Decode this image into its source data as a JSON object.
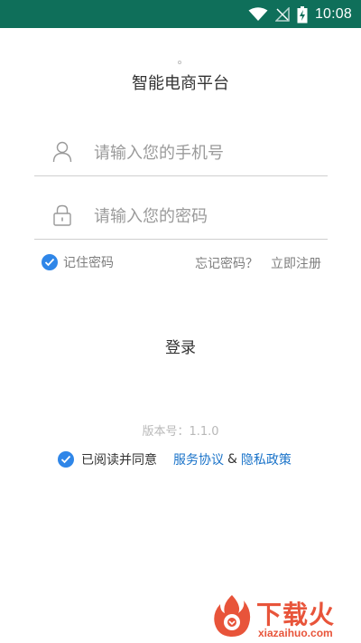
{
  "status_bar": {
    "time": "10:08",
    "icons": [
      "wifi-icon",
      "signal-off-icon",
      "battery-charging-icon"
    ]
  },
  "header": {
    "title": "智能电商平台"
  },
  "form": {
    "phone_placeholder": "请输入您的手机号",
    "phone_value": "",
    "password_placeholder": "请输入您的密码",
    "password_value": "",
    "remember_label": "记住密码",
    "forgot_password": "忘记密码？",
    "register": "立即注册",
    "login_label": "登录"
  },
  "footer": {
    "version": "版本号：1.1.0",
    "agree_text": "已阅读并同意",
    "service_agreement": "服务协议",
    "ampersand": "&",
    "privacy_policy": "隐私政策"
  },
  "watermark": {
    "brand": "下载火",
    "domain": "xiazaihuo.com"
  },
  "colors": {
    "status_bar": "#0f6f5a",
    "accent_blue": "#2f86e8",
    "link_blue": "#1a73c9",
    "watermark": "#e8543a"
  }
}
